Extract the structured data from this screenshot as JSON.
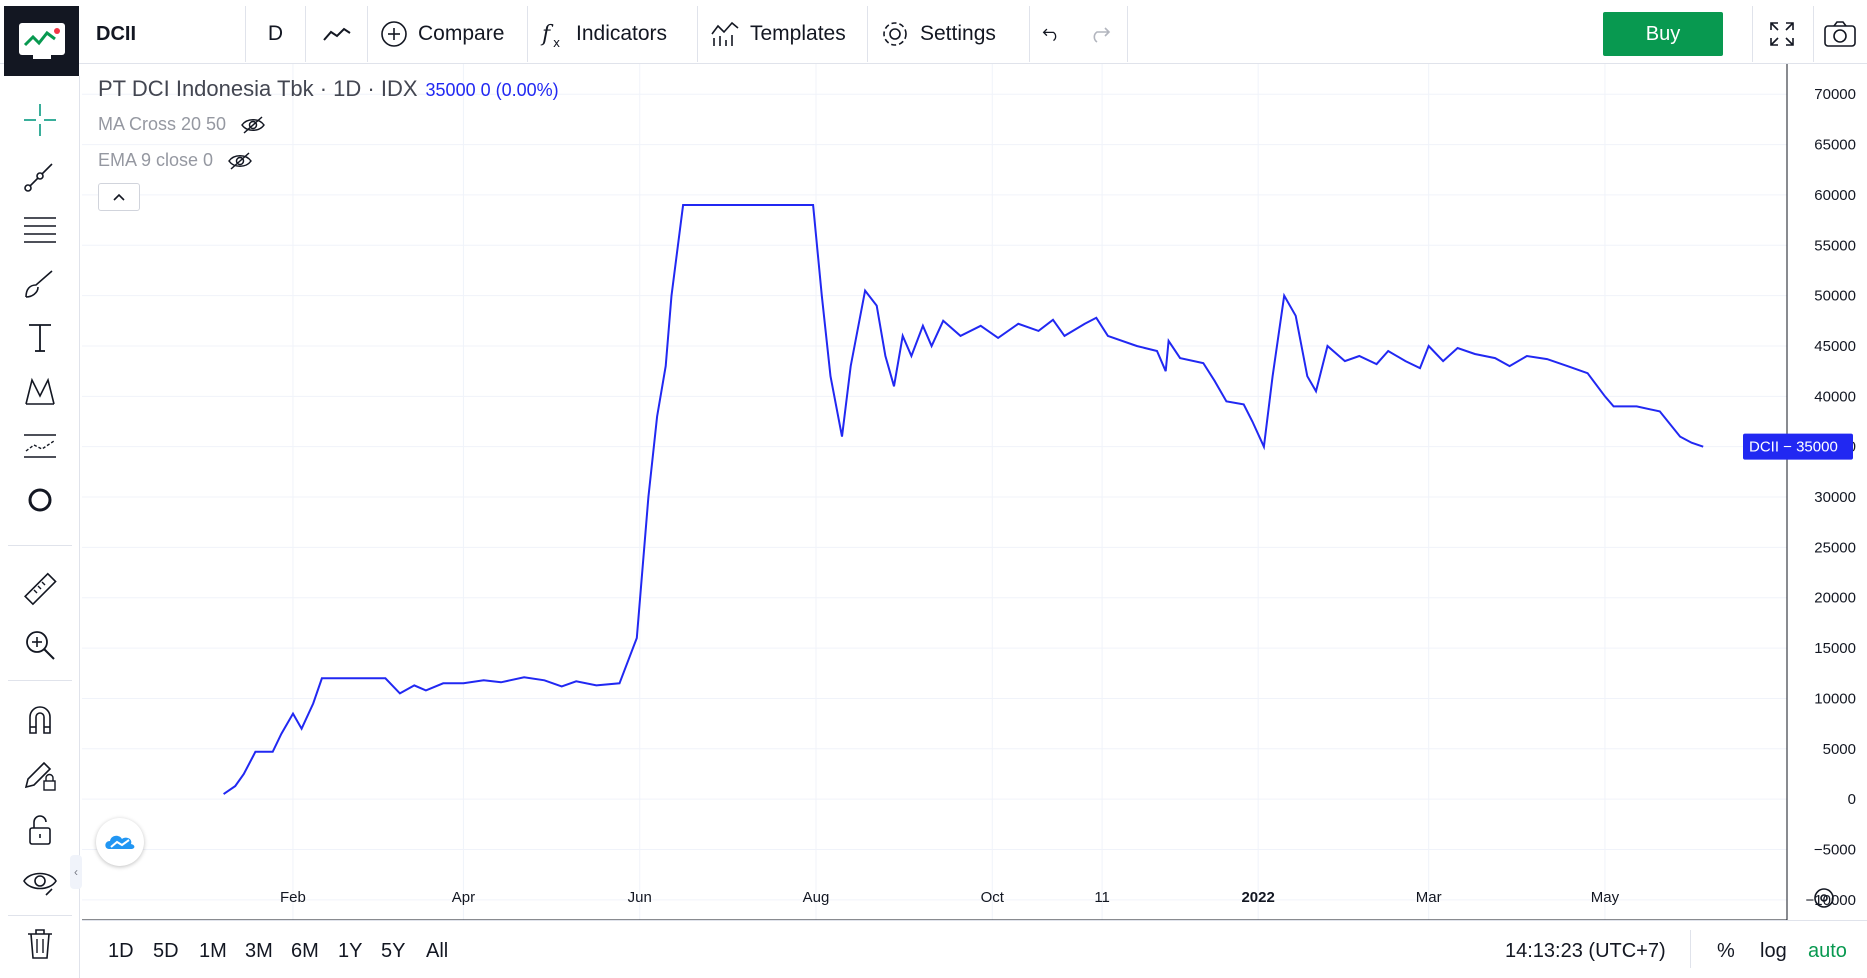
{
  "toolbar": {
    "symbol": "DCII",
    "interval": "D",
    "compare_label": "Compare",
    "indicators_label": "Indicators",
    "templates_label": "Templates",
    "settings_label": "Settings",
    "buy_label": "Buy"
  },
  "legend": {
    "title": "PT DCI Indonesia Tbk · 1D · IDX",
    "values": "35000  0 (0.00%)",
    "indicators": [
      "MA Cross 20 50",
      "EMA 9 close 0"
    ]
  },
  "price_badge": {
    "symbol": "DCII",
    "value": "35000"
  },
  "bottom": {
    "ranges": [
      "1D",
      "5D",
      "1M",
      "3M",
      "6M",
      "1Y",
      "5Y",
      "All"
    ],
    "clock": "14:13:23 (UTC+7)",
    "percent": "%",
    "log": "log",
    "auto": "auto"
  },
  "colors": {
    "line": "#2128f2",
    "buy": "#089950",
    "auto": "#089950"
  },
  "chart_data": {
    "type": "line",
    "y_ticks": [
      "70000",
      "65000",
      "60000",
      "55000",
      "50000",
      "45000",
      "40000",
      "35000",
      "30000",
      "25000",
      "20000",
      "15000",
      "10000",
      "5000",
      "0",
      "−5000",
      "−10000"
    ],
    "x_ticks": [
      "Feb",
      "Apr",
      "Jun",
      "Aug",
      "Oct",
      "11",
      "2022",
      "Mar",
      "May"
    ],
    "ylim": [
      -12000,
      73000
    ],
    "series": [
      {
        "values": [
          [
            "2021-01-08",
            500
          ],
          [
            "2021-01-12",
            1300
          ],
          [
            "2021-01-15",
            2500
          ],
          [
            "2021-01-19",
            4700
          ],
          [
            "2021-01-25",
            4700
          ],
          [
            "2021-01-28",
            6500
          ],
          [
            "2021-02-01",
            8500
          ],
          [
            "2021-02-04",
            7000
          ],
          [
            "2021-02-08",
            9500
          ],
          [
            "2021-02-11",
            12000
          ],
          [
            "2021-03-05",
            12000
          ],
          [
            "2021-03-10",
            10500
          ],
          [
            "2021-03-15",
            11300
          ],
          [
            "2021-03-19",
            10800
          ],
          [
            "2021-03-25",
            11500
          ],
          [
            "2021-04-01",
            11500
          ],
          [
            "2021-04-08",
            11800
          ],
          [
            "2021-04-14",
            11600
          ],
          [
            "2021-04-22",
            12100
          ],
          [
            "2021-04-29",
            11800
          ],
          [
            "2021-05-05",
            11200
          ],
          [
            "2021-05-10",
            11700
          ],
          [
            "2021-05-17",
            11300
          ],
          [
            "2021-05-25",
            11500
          ],
          [
            "2021-05-31",
            16000
          ],
          [
            "2021-06-04",
            30000
          ],
          [
            "2021-06-07",
            38000
          ],
          [
            "2021-06-10",
            43000
          ],
          [
            "2021-06-12",
            50000
          ],
          [
            "2021-06-16",
            59000
          ],
          [
            "2021-07-31",
            59000
          ],
          [
            "2021-08-03",
            50000
          ],
          [
            "2021-08-06",
            42000
          ],
          [
            "2021-08-10",
            36000
          ],
          [
            "2021-08-13",
            43000
          ],
          [
            "2021-08-18",
            50500
          ],
          [
            "2021-08-22",
            49000
          ],
          [
            "2021-08-25",
            44000
          ],
          [
            "2021-08-28",
            41000
          ],
          [
            "2021-08-31",
            46000
          ],
          [
            "2021-09-03",
            44000
          ],
          [
            "2021-09-07",
            47000
          ],
          [
            "2021-09-10",
            45000
          ],
          [
            "2021-09-14",
            47500
          ],
          [
            "2021-09-20",
            46000
          ],
          [
            "2021-09-27",
            47000
          ],
          [
            "2021-10-03",
            45800
          ],
          [
            "2021-10-10",
            47200
          ],
          [
            "2021-10-17",
            46500
          ],
          [
            "2021-10-22",
            47600
          ],
          [
            "2021-10-26",
            46000
          ],
          [
            "2021-11-02",
            47200
          ],
          [
            "2021-11-06",
            47800
          ],
          [
            "2021-11-10",
            46000
          ],
          [
            "2021-11-20",
            45000
          ],
          [
            "2021-11-27",
            44500
          ],
          [
            "2021-11-30",
            42500
          ],
          [
            "2021-12-01",
            45500
          ],
          [
            "2021-12-05",
            43800
          ],
          [
            "2021-12-13",
            43300
          ],
          [
            "2021-12-17",
            41500
          ],
          [
            "2021-12-21",
            39500
          ],
          [
            "2021-12-27",
            39200
          ],
          [
            "2021-12-30",
            37500
          ],
          [
            "2022-01-03",
            35000
          ],
          [
            "2022-01-06",
            42000
          ],
          [
            "2022-01-10",
            50000
          ],
          [
            "2022-01-14",
            48000
          ],
          [
            "2022-01-18",
            42000
          ],
          [
            "2022-01-21",
            40500
          ],
          [
            "2022-01-25",
            45000
          ],
          [
            "2022-01-31",
            43500
          ],
          [
            "2022-02-05",
            44000
          ],
          [
            "2022-02-11",
            43200
          ],
          [
            "2022-02-15",
            44500
          ],
          [
            "2022-02-21",
            43500
          ],
          [
            "2022-02-26",
            42800
          ],
          [
            "2022-03-01",
            45000
          ],
          [
            "2022-03-06",
            43500
          ],
          [
            "2022-03-11",
            44800
          ],
          [
            "2022-03-17",
            44200
          ],
          [
            "2022-03-24",
            43800
          ],
          [
            "2022-03-29",
            43000
          ],
          [
            "2022-04-04",
            44000
          ],
          [
            "2022-04-11",
            43700
          ],
          [
            "2022-04-18",
            43000
          ],
          [
            "2022-04-25",
            42300
          ],
          [
            "2022-05-01",
            40000
          ],
          [
            "2022-05-04",
            39000
          ],
          [
            "2022-05-12",
            39000
          ],
          [
            "2022-05-20",
            38500
          ],
          [
            "2022-05-27",
            36000
          ],
          [
            "2022-05-31",
            35400
          ],
          [
            "2022-06-04",
            35000
          ]
        ]
      }
    ],
    "grid": true
  }
}
